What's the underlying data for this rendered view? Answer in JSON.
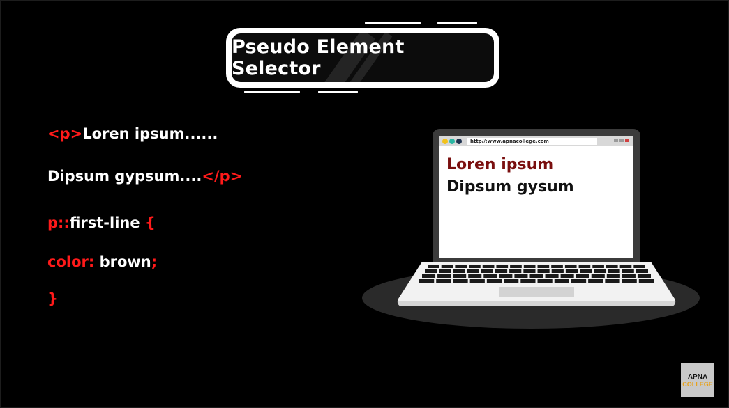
{
  "title": "Pseudo Element Selector",
  "code": {
    "line1": {
      "open_tag": "<p>",
      "text": "Loren ipsum......"
    },
    "line2": {
      "text": "Dipsum gypsum....",
      "close_tag": "</p>"
    },
    "line3": {
      "selector": "p::",
      "pseudo": "first-line",
      "brace": "{"
    },
    "line4": {
      "property": "color:",
      "value": "brown",
      "semicolon": ";"
    },
    "line5": {
      "brace": "}"
    }
  },
  "browser": {
    "url": "http//:www.apnacollege.com",
    "first_line": "Loren ipsum",
    "second_line": "Dipsum gysum"
  },
  "logo": {
    "top": "APNA",
    "bottom": "COLLEGE"
  },
  "colors": {
    "background": "#000000",
    "code_accent": "#ff1a1a",
    "first_line_brown": "#7a0f0f",
    "logo_accent": "#e8a21a"
  },
  "icons": [
    "laptop-icon",
    "browser-window-icon",
    "apna-college-logo"
  ]
}
